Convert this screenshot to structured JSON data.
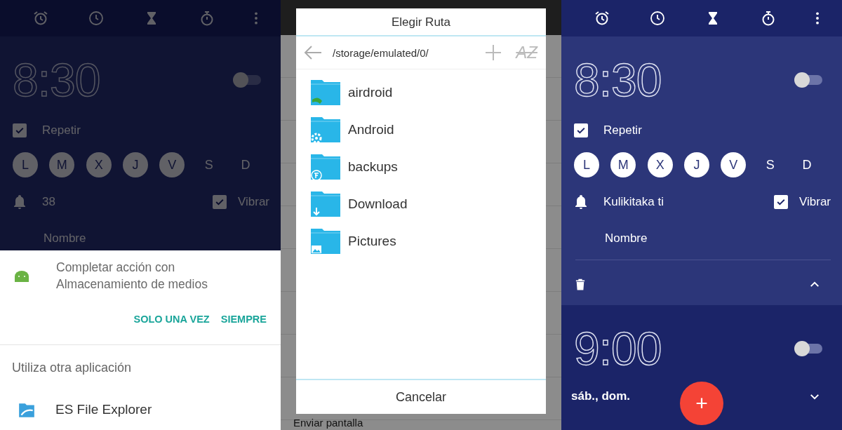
{
  "screens": [
    {
      "kind": "alarm_app",
      "dimmed": true,
      "alarms": [
        {
          "time": "8:30",
          "on": false,
          "expanded": true,
          "repeat": {
            "label": "Repetir",
            "checked": true
          },
          "days": [
            {
              "label": "L",
              "selected": true
            },
            {
              "label": "M",
              "selected": true
            },
            {
              "label": "X",
              "selected": true
            },
            {
              "label": "J",
              "selected": true
            },
            {
              "label": "V",
              "selected": true
            },
            {
              "label": "S",
              "selected": false
            },
            {
              "label": "D",
              "selected": false
            }
          ],
          "ringtone": "38",
          "vibrate": {
            "label": "Vibrar",
            "checked": true
          },
          "name": "Nombre"
        }
      ],
      "sheet": {
        "prompt": "Completar acción con Almacenamiento de medios",
        "buttons": [
          "SOLO UNA VEZ",
          "SIEMPRE"
        ],
        "other_heading": "Utiliza otra aplicación",
        "apps": [
          "ES File Explorer"
        ]
      }
    },
    {
      "kind": "file_dialog",
      "background_text": "Enviar pantalla",
      "dialog": {
        "title": "Elegir Ruta",
        "path": "/storage/emulated/0/",
        "sort_label": "AZ",
        "folders": [
          {
            "name": "airdroid",
            "kind": "app"
          },
          {
            "name": "Android",
            "kind": "gear"
          },
          {
            "name": "backups",
            "kind": "sync"
          },
          {
            "name": "Download",
            "kind": "download"
          },
          {
            "name": "Pictures",
            "kind": "image"
          }
        ],
        "cancel": "Cancelar"
      }
    },
    {
      "kind": "alarm_app",
      "dimmed": false,
      "alarms": [
        {
          "time": "8:30",
          "on": false,
          "expanded": true,
          "repeat": {
            "label": "Repetir",
            "checked": true
          },
          "days": [
            {
              "label": "L",
              "selected": true
            },
            {
              "label": "M",
              "selected": true
            },
            {
              "label": "X",
              "selected": true
            },
            {
              "label": "J",
              "selected": true
            },
            {
              "label": "V",
              "selected": true
            },
            {
              "label": "S",
              "selected": false
            },
            {
              "label": "D",
              "selected": false
            }
          ],
          "ringtone": "Kulikitaka ti",
          "vibrate": {
            "label": "Vibrar",
            "checked": true
          },
          "name": "Nombre"
        },
        {
          "time": "9:00",
          "on": false,
          "expanded": false,
          "summary": "sáb., dom."
        }
      ],
      "fab": "+"
    }
  ]
}
